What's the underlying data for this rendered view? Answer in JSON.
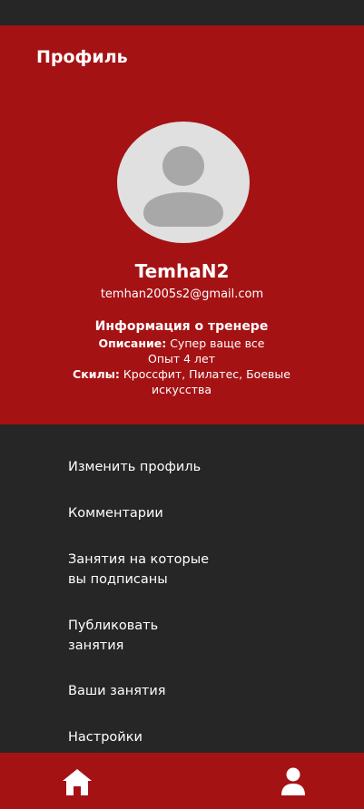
{
  "header": {
    "title": "Профиль"
  },
  "profile": {
    "username": "TemhaN2",
    "email": "temhan2005s2@gmail.com"
  },
  "trainer_info": {
    "title": "Информация о тренере",
    "description_label": "Описание:",
    "description_value": " Супер ваще все",
    "experience": "Опыт 4 лет",
    "skills_label": "Скилы:",
    "skills_value": " Кроссфит, Пилатес, Боевые искусства"
  },
  "menu": {
    "items": [
      {
        "label": "Изменить профиль"
      },
      {
        "label": "Комментарии"
      },
      {
        "label": "Занятия на которые вы подписаны"
      },
      {
        "label": "Публиковать занятия"
      },
      {
        "label": "Ваши занятия"
      },
      {
        "label": "Настройки"
      }
    ]
  },
  "bottom_nav": {
    "items": [
      {
        "icon": "home-icon"
      },
      {
        "icon": "user-icon"
      }
    ]
  },
  "colors": {
    "accent": "#a51214",
    "background": "#262626",
    "text": "#ffffff",
    "avatar_bg": "#e0e0e0",
    "avatar_fg": "#a8a8a8"
  }
}
